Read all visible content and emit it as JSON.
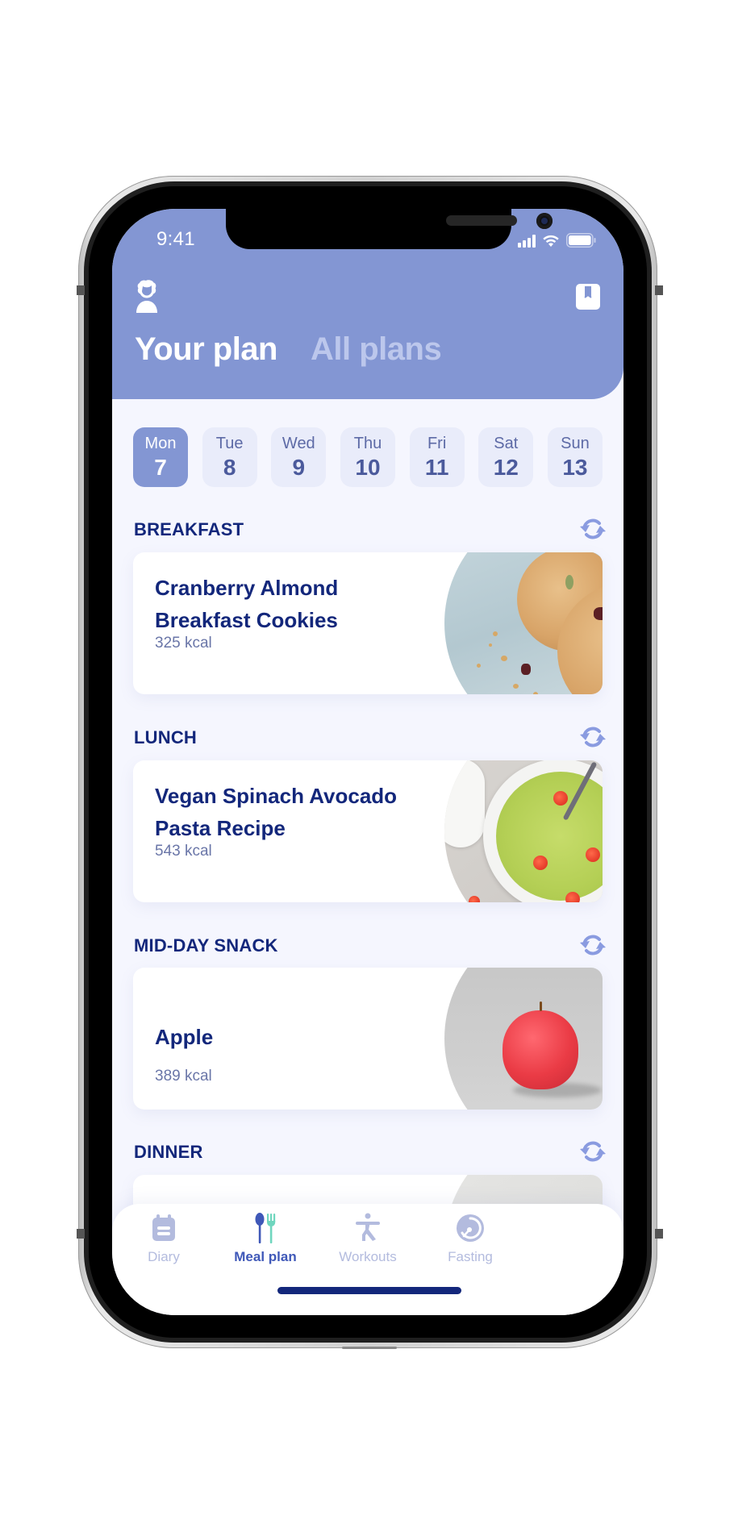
{
  "status_bar": {
    "time": "9:41",
    "icons": [
      "cellular-signal-icon",
      "wifi-icon",
      "battery-icon"
    ]
  },
  "header": {
    "left_icon": "profile-icon",
    "right_icon": "recipe-book-icon",
    "tabs": [
      {
        "label": "Your plan",
        "active": true
      },
      {
        "label": "All plans",
        "active": false
      }
    ]
  },
  "colors": {
    "header_bg": "#8396d3",
    "page_bg": "#f5f6fe",
    "heading": "#13277b",
    "accent": "#3f58b8",
    "accent_green": "#6fd6be",
    "inactive": "#b3bbde"
  },
  "days": [
    {
      "name": "Mon",
      "num": "7",
      "active": true
    },
    {
      "name": "Tue",
      "num": "8",
      "active": false
    },
    {
      "name": "Wed",
      "num": "9",
      "active": false
    },
    {
      "name": "Thu",
      "num": "10",
      "active": false
    },
    {
      "name": "Fri",
      "num": "11",
      "active": false
    },
    {
      "name": "Sat",
      "num": "12",
      "active": false
    },
    {
      "name": "Sun",
      "num": "13",
      "active": false
    }
  ],
  "meals": [
    {
      "section": "BREAKFAST",
      "title": "Cranberry Almond Breakfast Cookies",
      "kcal": "325 kcal",
      "image": "cranberry-cookies-photo",
      "action_icon": "refresh-icon"
    },
    {
      "section": "LUNCH",
      "title": "Vegan Spinach Avocado Pasta Recipe",
      "kcal": "543 kcal",
      "image": "spinach-pasta-photo",
      "action_icon": "refresh-icon"
    },
    {
      "section": "MID-DAY SNACK",
      "title": "Apple",
      "kcal": "389 kcal",
      "image": "apple-photo",
      "action_icon": "refresh-icon"
    },
    {
      "section": "DINNER",
      "title": "",
      "kcal": "",
      "image": "dinner-photo",
      "action_icon": "refresh-icon"
    }
  ],
  "tab_bar": {
    "tabs": [
      {
        "label": "Diary",
        "icon": "diary-calendar-icon",
        "active": false
      },
      {
        "label": "Meal plan",
        "icon": "spoon-fork-icon",
        "active": true
      },
      {
        "label": "Workouts",
        "icon": "running-person-icon",
        "active": false
      },
      {
        "label": "Fasting",
        "icon": "fasting-clock-icon",
        "active": false
      }
    ]
  }
}
